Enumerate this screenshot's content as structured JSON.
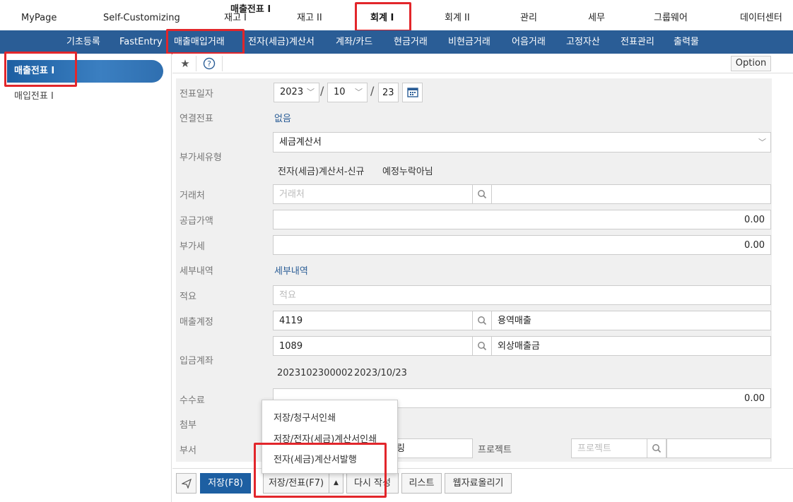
{
  "topnav": {
    "tabs": [
      {
        "label": "MyPage"
      },
      {
        "label": "Self-Customizing"
      },
      {
        "label": "재고 I"
      },
      {
        "label": "재고 II"
      },
      {
        "label": "회계 I"
      },
      {
        "label": "회계 II"
      },
      {
        "label": "관리"
      },
      {
        "label": "세무"
      },
      {
        "label": "그룹웨어"
      },
      {
        "label": "데이터센터"
      }
    ]
  },
  "subnav": {
    "items": [
      {
        "label": "기초등록"
      },
      {
        "label": "FastEntry"
      },
      {
        "label": "매출매입거래"
      },
      {
        "label": "전자(세금)계산서"
      },
      {
        "label": "계좌/카드"
      },
      {
        "label": "현금거래"
      },
      {
        "label": "비현금거래"
      },
      {
        "label": "어음거래"
      },
      {
        "label": "고정자산"
      },
      {
        "label": "전표관리"
      },
      {
        "label": "출력물"
      }
    ]
  },
  "sidebar": {
    "items": [
      {
        "label": "매출전표 I"
      },
      {
        "label": "매입전표 I"
      }
    ]
  },
  "header": {
    "title": "매출전표 I",
    "option_label": "Option"
  },
  "form": {
    "date_label": "전표일자",
    "year": "2023",
    "month": "10",
    "day": "23",
    "linked_label": "연결전표",
    "linked_value": "없음",
    "vat_type_label": "부가세유형",
    "vat_type_value": "세금계산서",
    "vat_type_sub1": "전자(세금)계산서-신규",
    "vat_type_sub2": "예정누락아님",
    "client_label": "거래처",
    "client_placeholder": "거래처",
    "supply_label": "공급가액",
    "supply_value": "0.00",
    "vat_label": "부가세",
    "vat_value": "0.00",
    "detail_label": "세부내역",
    "detail_link": "세부내역",
    "memo_label": "적요",
    "memo_placeholder": "적요",
    "sales_account_label": "매출계정",
    "sales_account_code": "4119",
    "sales_account_name": "용역매출",
    "deposit_label": "입금계좌",
    "deposit_code": "1089",
    "deposit_name": "외상매출금",
    "deposit_ref_no": "2023102300002",
    "deposit_ref_date": "2023/10/23",
    "fee_label": "수수료",
    "fee_value": "0.00",
    "attach_label": "첨부",
    "dept_label": "부서",
    "dept_partial": "링",
    "project_label": "프로젝트",
    "project_placeholder": "프로젝트"
  },
  "footer": {
    "save_label": "저장(F8)",
    "save_voucher_label": "저장/전표(F7)",
    "rewrite_label": "다시 작성",
    "list_label": "리스트",
    "upload_label": "웹자료올리기"
  },
  "dropdown": {
    "items": [
      {
        "label": "저장/청구서인쇄"
      },
      {
        "label": "저장/전자(세금)계산서인쇄"
      },
      {
        "label": "전자(세금)계산서발행"
      }
    ]
  },
  "colors": {
    "brand": "#2a5d96",
    "highlight": "#e2262b"
  }
}
